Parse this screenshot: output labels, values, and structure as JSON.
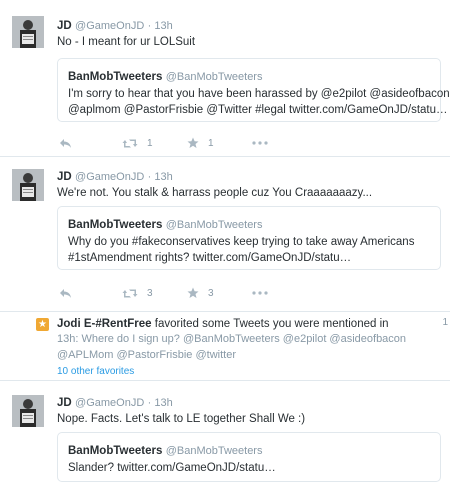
{
  "tweets": [
    {
      "fullname": "JD",
      "handle": "@GameOnJD",
      "time": "· 13h",
      "text": "No - I meant for ur LOLSuit",
      "quote": {
        "name": "BanMobTweeters",
        "handle": "@BanMobTweeters",
        "line1": "I'm sorry to hear that you have been harassed by @e2pilot @asideofbacon",
        "line2": "@aplmom @PastorFrisbie @Twitter #legal twitter.com/GameOnJD/statu…"
      },
      "retweets": "1",
      "favorites": "1"
    },
    {
      "fullname": "JD",
      "handle": "@GameOnJD",
      "time": "· 13h",
      "text": "We're not. You stalk & harrass people cuz You Craaaaaaazy...",
      "quote": {
        "name": "BanMobTweeters",
        "handle": "@BanMobTweeters",
        "line1": "Why do you #fakeconservatives keep trying to take away Americans",
        "line2": "#1stAmendment rights?  twitter.com/GameOnJD/statu…"
      },
      "retweets": "3",
      "favorites": "3"
    },
    {
      "fullname": "JD",
      "handle": "@GameOnJD",
      "time": "· 13h",
      "text": "Nope. Facts. Let's talk to LE together Shall We :)",
      "quote": {
        "name": "BanMobTweeters",
        "handle": "@BanMobTweeters",
        "line1": "Slander?  twitter.com/GameOnJD/statu…"
      }
    }
  ],
  "notification": {
    "name": "Jodi E-#RentFree",
    "action": "favorited some Tweets you were mentioned in",
    "line2": "13h: Where do I sign up? @BanMobTweeters @e2pilot @asideofbacon",
    "line3": "@APLMom @PastorFrisbie @twitter",
    "more": "10 other favorites",
    "edge_char": "1"
  },
  "icons": {
    "reply": "reply-arrow-icon",
    "retweet": "retweet-icon",
    "favorite": "star-icon",
    "more": "ellipsis-icon",
    "badge": "star-badge-icon"
  },
  "colors": {
    "text": "#292f33",
    "muted": "#8899a6",
    "icon": "#aab8c2",
    "link": "#2a9be3",
    "border": "#e1e8ed",
    "badge": "#f0a833"
  }
}
